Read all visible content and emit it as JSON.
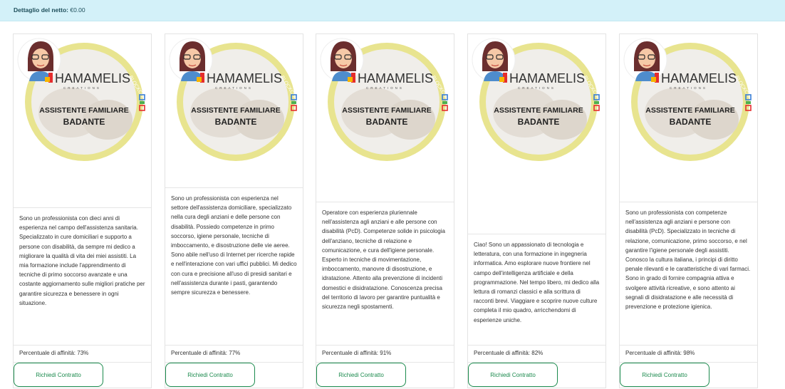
{
  "banner": {
    "label": "Dettaglio del netto:",
    "value": "€0.00"
  },
  "badge": {
    "brand": "HAMAMELIS",
    "brand_sub": "CREATIONS",
    "title_line1": "ASSISTENTE FAMILIARE",
    "title_line2": "BADANTE",
    "ring_text_top": "BLOCKCHAIN",
    "ring_text_bottom": "CERTIFIED",
    "ring_color": "#e5e08a",
    "accent_colors": [
      "#e52d2d",
      "#3a7fd5",
      "#4caf50",
      "#f7b500"
    ]
  },
  "cards": [
    {
      "bio": "Sono un professionista con dieci anni di esperienza nel campo dell'assistenza sanitaria. Specializzato in cure domiciliari e supporto a persone con disabilità, da sempre mi dedico a migliorare la qualità di vita dei miei assistiti. La mia formazione include l'apprendimento di tecniche di primo soccorso avanzate e una costante aggiornamento sulle migliori pratiche per garantire sicurezza e benessere in ogni situazione.",
      "affinity": "Percentuale di affinità: 73%",
      "cta": "Richiedi Contratto"
    },
    {
      "bio": "Sono un professionista con esperienza nel settore dell'assistenza domiciliare, specializzato nella cura degli anziani e delle persone con disabilità. Possiedo competenze in primo soccorso, igiene personale, tecniche di imboccamento, e disostruzione delle vie aeree. Sono abile nell'uso di Internet per ricerche rapide e nell'interazione con vari uffici pubblici. Mi dedico con cura e precisione all'uso di presidi sanitari e nell'assistenza durante i pasti, garantendo sempre sicurezza e benessere.",
      "affinity": "Percentuale di affinità: 77%",
      "cta": "Richiedi Contratto"
    },
    {
      "bio": "Operatore con esperienza pluriennale nell'assistenza agli anziani e alle persone con disabilità (PcD). Competenze solide in psicologia dell'anziano, tecniche di relazione e comunicazione, e cura dell'igiene personale. Esperto in tecniche di movimentazione, imboccamento, manovre di disostruzione, e idratazione. Attento alla prevenzione di incidenti domestici e disidratazione. Conoscenza precisa del territorio di lavoro per garantire puntualità e sicurezza negli spostamenti.",
      "affinity": "Percentuale di affinità: 91%",
      "cta": "Richiedi Contratto"
    },
    {
      "bio": "Ciao! Sono un appassionato di tecnologia e letteratura, con una formazione in ingegneria informatica. Amo esplorare nuove frontiere nel campo dell'intelligenza artificiale e della programmazione. Nel tempo libero, mi dedico alla lettura di romanzi classici e alla scrittura di racconti brevi. Viaggiare e scoprire nuove culture completa il mio quadro, arricchendomi di esperienze uniche.",
      "affinity": "Percentuale di affinità: 82%",
      "cta": "Richiedi Contratto"
    },
    {
      "bio": "Sono un professionista con competenze nell'assistenza agli anziani e persone con disabilità (PcD). Specializzato in tecniche di relazione, comunicazione, primo soccorso, e nel garantire l'igiene personale degli assistiti. Conosco la cultura italiana, i principi di diritto penale rilevanti e le caratteristiche di vari farmaci. Sono in grado di fornire compagnia attiva e svolgere attività ricreative, e sono attento ai segnali di disidratazione e alle necessità di prevenzione e protezione igienica.",
      "affinity": "Percentuale di affinità: 98%",
      "cta": "Richiedi Contratto"
    }
  ]
}
